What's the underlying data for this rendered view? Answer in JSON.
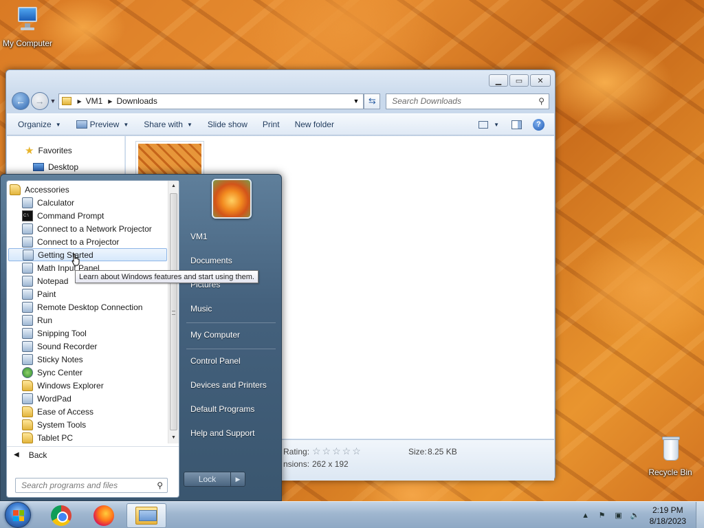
{
  "desktop": {
    "icons": [
      {
        "label": "My Computer"
      },
      {
        "label": "Recycle Bin"
      }
    ]
  },
  "explorer": {
    "breadcrumbs": [
      "VM1",
      "Downloads"
    ],
    "search_placeholder": "Search Downloads",
    "toolbar": {
      "organize": "Organize",
      "preview": "Preview",
      "share_with": "Share with",
      "slide_show": "Slide show",
      "print": "Print",
      "new_folder": "New folder"
    },
    "nav": {
      "favorites": "Favorites",
      "desktop": "Desktop"
    },
    "details": {
      "rating_label": "Rating:",
      "size_label": "Size:",
      "size_value": "8.25 KB",
      "dimensions_label": "nsions:",
      "dimensions_value": "262 x 192"
    }
  },
  "start_menu": {
    "programs": [
      {
        "label": "Accessories",
        "type": "folder",
        "level": 0
      },
      {
        "label": "Calculator",
        "type": "app",
        "level": 1
      },
      {
        "label": "Command Prompt",
        "type": "cmd",
        "level": 1
      },
      {
        "label": "Connect to a Network Projector",
        "type": "app",
        "level": 1
      },
      {
        "label": "Connect to a Projector",
        "type": "app",
        "level": 1
      },
      {
        "label": "Getting Started",
        "type": "app",
        "level": 1,
        "hover": true
      },
      {
        "label": "Math Input Panel",
        "type": "app",
        "level": 1
      },
      {
        "label": "Notepad",
        "type": "app",
        "level": 1
      },
      {
        "label": "Paint",
        "type": "app",
        "level": 1
      },
      {
        "label": "Remote Desktop Connection",
        "type": "app",
        "level": 1
      },
      {
        "label": "Run",
        "type": "app",
        "level": 1
      },
      {
        "label": "Snipping Tool",
        "type": "app",
        "level": 1
      },
      {
        "label": "Sound Recorder",
        "type": "app",
        "level": 1
      },
      {
        "label": "Sticky Notes",
        "type": "app",
        "level": 1
      },
      {
        "label": "Sync Center",
        "type": "app",
        "level": 1
      },
      {
        "label": "Windows Explorer",
        "type": "app",
        "level": 1
      },
      {
        "label": "WordPad",
        "type": "app",
        "level": 1
      },
      {
        "label": "Ease of Access",
        "type": "folder",
        "level": 1
      },
      {
        "label": "System Tools",
        "type": "folder",
        "level": 1
      },
      {
        "label": "Tablet PC",
        "type": "folder",
        "level": 1
      }
    ],
    "back_label": "Back",
    "search_placeholder": "Search programs and files",
    "tooltip": "Learn about Windows features and start using them.",
    "right_items": {
      "user": "VM1",
      "documents": "Documents",
      "pictures": "Pictures",
      "music": "Music",
      "my_computer": "My Computer",
      "control_panel": "Control Panel",
      "devices_printers": "Devices and Printers",
      "default_programs": "Default Programs",
      "help_support": "Help and Support"
    },
    "lock_label": "Lock"
  },
  "taskbar": {
    "time": "2:19 PM",
    "date": "8/18/2023"
  }
}
